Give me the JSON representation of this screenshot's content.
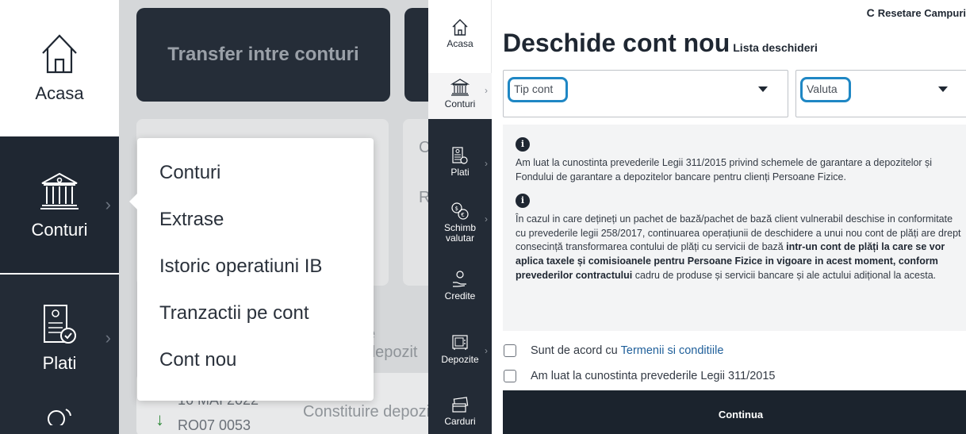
{
  "left_panel": {
    "nav": {
      "home_label": "Acasa",
      "accounts_label": "Conturi",
      "payments_label": "Plati"
    },
    "tile_title": "Transfer intre conturi",
    "faded_texts": [
      "Cl",
      "R",
      "e depozit"
    ],
    "row_date": "16 MAI 2022",
    "row_ref": "RO07 0053",
    "row_desc": "Constituire depozit",
    "popup_menu": [
      "Conturi",
      "Extrase",
      "Istoric operatiuni IB",
      "Tranzactii pe cont",
      "Cont nou"
    ]
  },
  "sidebar": {
    "items": [
      {
        "label": "Acasa",
        "icon": "home-icon"
      },
      {
        "label": "Conturi",
        "icon": "bank-icon"
      },
      {
        "label": "Plati",
        "icon": "invoice-icon"
      },
      {
        "label": "Schimb valutar",
        "icon": "currency-exchange-icon"
      },
      {
        "label": "Credite",
        "icon": "credit-hand-icon"
      },
      {
        "label": "Depozite",
        "icon": "safe-icon"
      },
      {
        "label": "Carduri",
        "icon": "cards-icon"
      }
    ]
  },
  "page": {
    "reset_label": "Resetare Campuri",
    "title": "Deschide cont nou",
    "subtitle_link": "Lista deschideri",
    "account_type_placeholder": "Tip cont",
    "currency_placeholder": "Valuta",
    "info": {
      "p1": "Am luat la cunostinta prevederile Legii 311/2015 privind schemele de garantare a depozitelor și Fondului de garantare a depozitelor bancare pentru clienți Persoane Fizice.",
      "p2_plain": "În cazul in care dețineți un pachet de bază/pachet de bază client vulnerabil deschise in conformitate cu prevederile legii 258/2017, continuarea operațiunii de deschidere a unui nou cont de plăți are drept consecință transformarea contului de plăți cu servicii de bază ",
      "p2_bold": "intr-un cont de plăți la care se vor aplica taxele și comisioanele pentru Persoane Fizice in vigoare in acest moment, conform prevederilor contractului",
      "p2_tail": " cadru de produse și servicii bancare și ale actului adițional la acesta."
    },
    "check_terms_prefix": "Sunt de acord cu",
    "check_terms_link": "Termenii si conditiile",
    "check_law": "Am luat la cunostinta prevederile Legii 311/2015",
    "continue_label": "Continua"
  },
  "colors": {
    "dark_navy": "#1f2732",
    "highlight_blue": "#1f87c4",
    "link_blue": "#1f5f9a"
  }
}
